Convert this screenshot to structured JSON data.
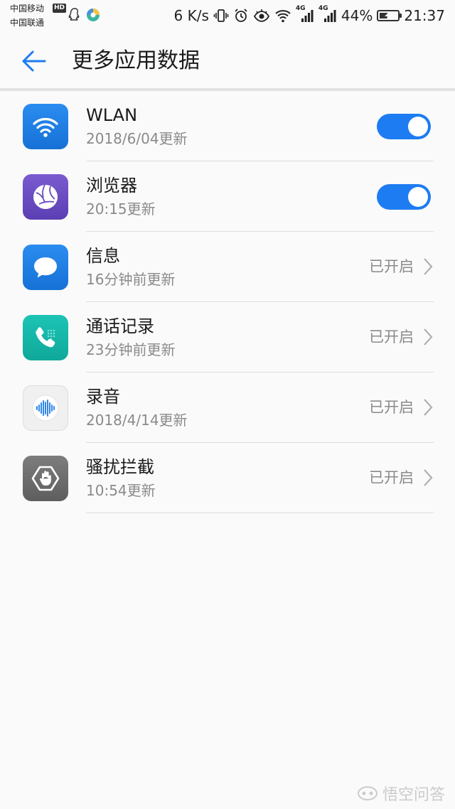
{
  "status_bar": {
    "carrier_1": "中国移动",
    "carrier_2": "中国联通",
    "hd_badge": "HD",
    "network_speed": "6 K/s",
    "network_type_1": "4G",
    "network_type_2": "4G",
    "battery_percent": "44%",
    "battery_level": 0.44,
    "time": "21:37",
    "icons": [
      "qq-icon",
      "colorful-app-icon",
      "vibrate-icon",
      "alarm-icon",
      "eye-icon",
      "wifi-icon",
      "signal-icon",
      "signal-icon",
      "battery-charging-icon"
    ]
  },
  "header": {
    "back_icon": "arrow-left-icon",
    "title": "更多应用数据"
  },
  "apps": [
    {
      "name": "WLAN",
      "subtitle": "2018/6/04更新",
      "icon": "wifi-app-icon",
      "control": "toggle",
      "enabled": true
    },
    {
      "name": "浏览器",
      "subtitle": "20:15更新",
      "icon": "browser-app-icon",
      "control": "toggle",
      "enabled": true
    },
    {
      "name": "信息",
      "subtitle": "16分钟前更新",
      "icon": "messages-app-icon",
      "control": "status",
      "status": "已开启"
    },
    {
      "name": "通话记录",
      "subtitle": "23分钟前更新",
      "icon": "phone-app-icon",
      "control": "status",
      "status": "已开启"
    },
    {
      "name": "录音",
      "subtitle": "2018/4/14更新",
      "icon": "recorder-app-icon",
      "control": "status",
      "status": "已开启"
    },
    {
      "name": "骚扰拦截",
      "subtitle": "10:54更新",
      "icon": "harassment-block-app-icon",
      "control": "status",
      "status": "已开启"
    }
  ],
  "watermark": {
    "text": "悟空问答"
  },
  "colors": {
    "accent": "#1d7cf2",
    "background": "#fafafa",
    "secondary_text": "#8a8a8a"
  }
}
